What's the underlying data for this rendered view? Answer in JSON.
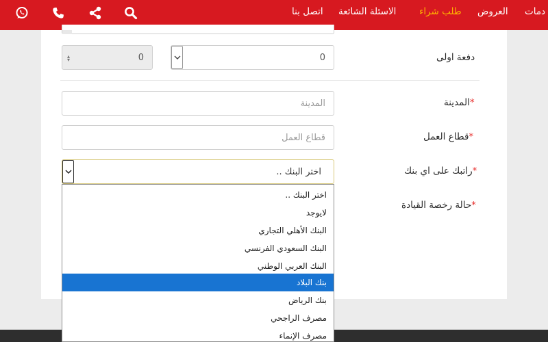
{
  "nav": {
    "links": [
      "اتصل بنا",
      "الاسئلة الشائعة",
      "طلب شراء",
      "العروض",
      "دمات"
    ],
    "active": "طلب شراء",
    "icons": [
      "whatsapp-icon",
      "phone-icon",
      "share-icon",
      "search-icon"
    ]
  },
  "colors": {
    "header": "#d71920",
    "active_link": "#ffb400",
    "required": "#e8302e",
    "selected_option": "#1874d2"
  },
  "form": {
    "down_payment": {
      "label": "دفعة اولى",
      "select_value": "0",
      "number_value": "0"
    },
    "city": {
      "label": "المدينة",
      "required": "*",
      "placeholder": "المدينة"
    },
    "work_sector": {
      "label": "قطاع العمل",
      "required": "*",
      "placeholder": "قطاع العمل"
    },
    "salary_bank": {
      "label": "راتبك على اي بنك",
      "required": "*",
      "selected": "اختر البنك .."
    },
    "license": {
      "label": "حالة رخصة القيادة",
      "required": "*"
    }
  },
  "bank_options": [
    "اختر البنك ..",
    "لايوجد",
    "البنك الأهلي التجاري",
    "البنك السعودي الفرنسي",
    "البنك العربي الوطني",
    "بنك البلاد",
    "بنك الرياض",
    "مصرف الراجحي",
    "مصرف الإنماء"
  ],
  "highlighted_option": "بنك البلاد"
}
